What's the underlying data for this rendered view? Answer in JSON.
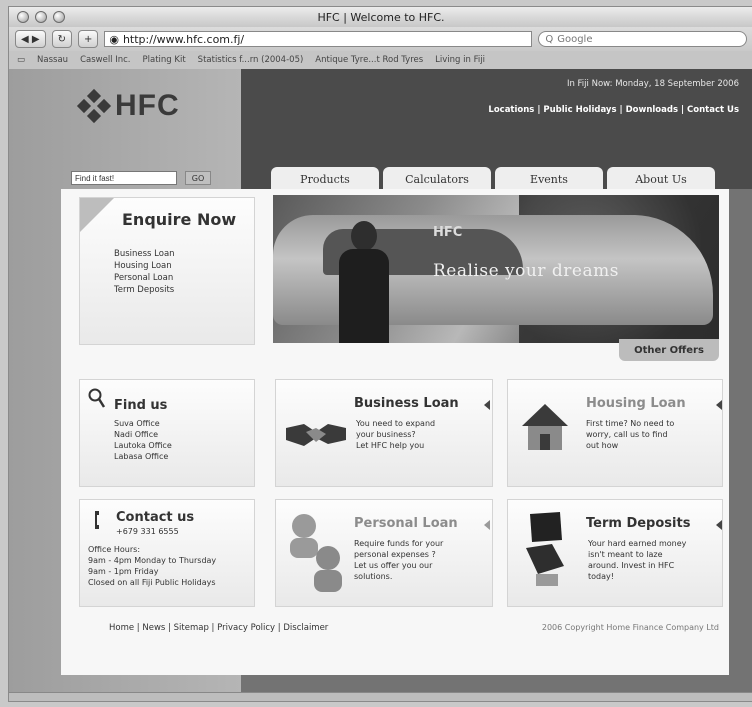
{
  "window": {
    "title": "HFC | Welcome to HFC."
  },
  "toolbar": {
    "back_label": "◀ ▶",
    "reload_label": "↻",
    "add_label": "+",
    "url": "http://www.hfc.com.fj/",
    "search_placeholder": "Google"
  },
  "bookmarks": [
    "Nassau",
    "Caswell Inc.",
    "Plating Kit",
    "Statistics f...rn (2004-05)",
    "Antique Tyre...t Rod Tyres",
    "Living in Fiji"
  ],
  "header": {
    "logo_text": "HFC",
    "fiji_now": "In Fiji Now: Monday, 18 September 2006",
    "links": [
      "Locations",
      "Public Holidays",
      "Downloads",
      "Contact Us"
    ],
    "search_placeholder": "Find it fast!",
    "go_label": "GO"
  },
  "tabs": [
    "Products",
    "Calculators",
    "Events",
    "About Us"
  ],
  "enquire": {
    "title": "Enquire Now",
    "items": [
      "Business Loan",
      "Housing Loan",
      "Personal Loan",
      "Term Deposits"
    ]
  },
  "banner": {
    "text": "Realise your dreams",
    "brand": "HFC",
    "offers_label": "Other Offers"
  },
  "find_us": {
    "title": "Find us",
    "items": [
      "Suva Office",
      "Nadi Office",
      "Lautoka Office",
      "Labasa Office"
    ]
  },
  "contact_us": {
    "title": "Contact us",
    "phone": "+679 331 6555",
    "hours_title": "Office Hours:",
    "hours": [
      "9am - 4pm  Monday to Thursday",
      "9am - 1pm  Friday",
      "Closed on all Fiji Public Holidays"
    ]
  },
  "business_loan": {
    "title": "Business Loan",
    "lines": [
      "You need to expand",
      "your business?",
      "Let HFC help you"
    ]
  },
  "housing_loan": {
    "title": "Housing Loan",
    "lines": [
      "First time? No need to",
      "worry, call us to find",
      "out how"
    ]
  },
  "personal_loan": {
    "title": "Personal Loan",
    "lines": [
      "Require funds for your",
      "personal expenses ?",
      "Let us offer you our",
      "solutions."
    ]
  },
  "term_deposits": {
    "title": "Term Deposits",
    "lines": [
      "Your hard earned money",
      "isn't meant to laze",
      "around. Invest in HFC",
      "today!"
    ]
  },
  "footer": {
    "links": [
      "Home",
      "News",
      "Sitemap",
      "Privacy Policy",
      "Disclaimer"
    ],
    "copyright": "2006 Copyright Home Finance Company Ltd"
  }
}
